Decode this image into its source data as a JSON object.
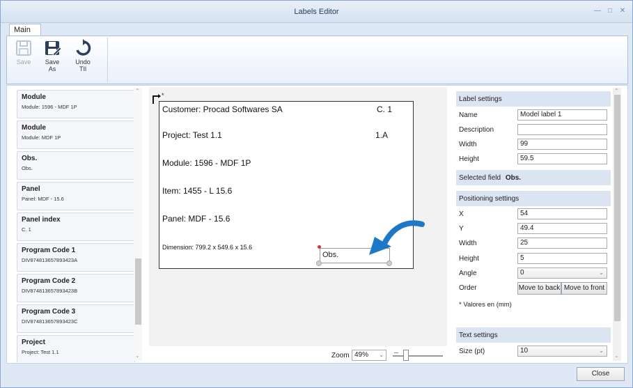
{
  "window": {
    "title": "Labels Editor",
    "controls": [
      "—",
      "□",
      "✕"
    ]
  },
  "ribbon": {
    "tab": "Main",
    "buttons": [
      {
        "label": "Save",
        "icon": "save-icon",
        "enabled": false
      },
      {
        "label": "Save\nAs",
        "icon": "save-as-icon",
        "enabled": true
      },
      {
        "label": "Undo\nTIl",
        "icon": "undo-icon",
        "enabled": true
      }
    ]
  },
  "field_list": [
    {
      "title": "Module",
      "subtitle": "Module: 1596 - MDF 1P"
    },
    {
      "title": "Module",
      "subtitle": "Module: MDF 1P"
    },
    {
      "title": "Obs.",
      "subtitle": "Obs."
    },
    {
      "title": "Panel",
      "subtitle": "Panel: MDF - 15.6"
    },
    {
      "title": "Panel index",
      "subtitle": "C. 1"
    },
    {
      "title": "Program Code 1",
      "subtitle": "DIV874813657893423A"
    },
    {
      "title": "Program Code 2",
      "subtitle": "DIV874813657893423B"
    },
    {
      "title": "Program Code 3",
      "subtitle": "DIV874813657893423C"
    },
    {
      "title": "Project",
      "subtitle": "Project: Test 1.1"
    }
  ],
  "label_canvas": {
    "customer": "Customer: Procad Softwares SA",
    "panel_index": "C. 1",
    "project": "Project: Test 1.1",
    "project_code": "1.A",
    "module": "Module: 1596 - MDF 1P",
    "item": "Item: 1455 - L 15.6",
    "panel": "Panel: MDF - 15.6",
    "dimension": "Dimension: 799.2 x 549.6 x 15.6",
    "obs": "Obs.",
    "corner_marker": "*"
  },
  "zoom": {
    "label": "Zoom",
    "value": "49%"
  },
  "settings": {
    "label_settings_title": "Label settings",
    "name_label": "Name",
    "name_value": "Model label 1",
    "description_label": "Description",
    "description_value": "",
    "width_label": "Width",
    "width_value": "99",
    "height_label": "Height",
    "height_value": "59.5",
    "selected_field_label": "Selected field",
    "selected_field_value": "Obs.",
    "positioning_title": "Positioning settings",
    "x_label": "X",
    "x_value": "54",
    "y_label": "Y",
    "y_value": "49.4",
    "pwidth_label": "Width",
    "pwidth_value": "25",
    "pheight_label": "Height",
    "pheight_value": "5",
    "angle_label": "Angle",
    "angle_value": "0",
    "order_label": "Order",
    "move_back": "Move to back",
    "move_front": "Move to front",
    "units_note": "* Valores en (mm)",
    "text_settings_title": "Text settings",
    "size_label": "Size (pt)",
    "size_value": "10"
  },
  "close_label": "Close"
}
